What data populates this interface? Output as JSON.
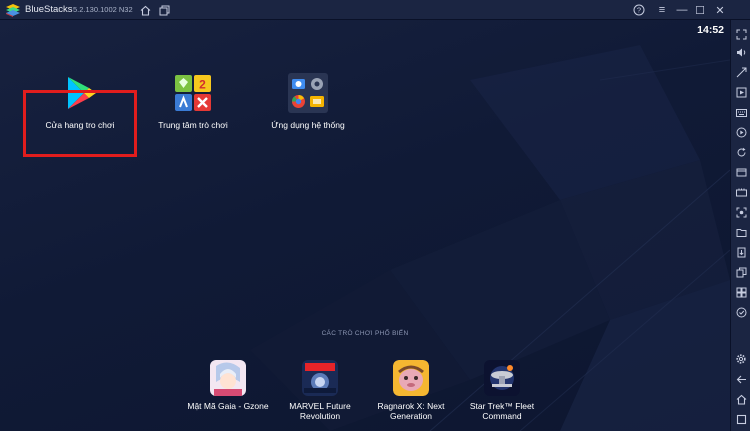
{
  "window": {
    "app_name": "BlueStacks",
    "version": "5.2.130.1002 N32",
    "help_glyph": "?",
    "menu_glyph": "≡",
    "minimize_glyph": "—",
    "maximize_glyph": "☐",
    "close_glyph": "✕"
  },
  "status": {
    "time": "14:52"
  },
  "desktop_apps": [
    {
      "label": "Cửa hang tro chơi",
      "icon": "play-store-icon"
    },
    {
      "label": "Trung tâm trò chơi",
      "icon": "game-center-icon"
    },
    {
      "label": "Ứng dụng hệ thống",
      "icon": "system-apps-icon"
    }
  ],
  "popular_games": {
    "section_title": "CÁC TRÒ CHƠI PHỔ BIẾN",
    "items": [
      {
        "line1": "Mật Mã Gaia - Gzone",
        "line2": ""
      },
      {
        "line1": "MARVEL Future",
        "line2": "Revolution"
      },
      {
        "line1": "Ragnarok X: Next",
        "line2": "Generation"
      },
      {
        "line1": "Star Trek™ Fleet",
        "line2": "Command"
      }
    ]
  },
  "sidebar_icons": [
    "fullscreen-icon",
    "volume-icon",
    "keyboard-mapping-icon",
    "cast-icon",
    "keyboard-icon",
    "record-icon",
    "refresh-icon",
    "screenshot-folder-icon",
    "macro-icon",
    "screen-capture-icon",
    "folder-icon",
    "apk-install-icon",
    "copy-icon",
    "multi-instance-icon",
    "eco-mode-icon",
    "settings-icon",
    "back-icon",
    "home-icon",
    "recents-icon"
  ],
  "colors": {
    "highlight": "#e11d1d",
    "background": "#0d1530",
    "chrome": "#1b2542"
  }
}
